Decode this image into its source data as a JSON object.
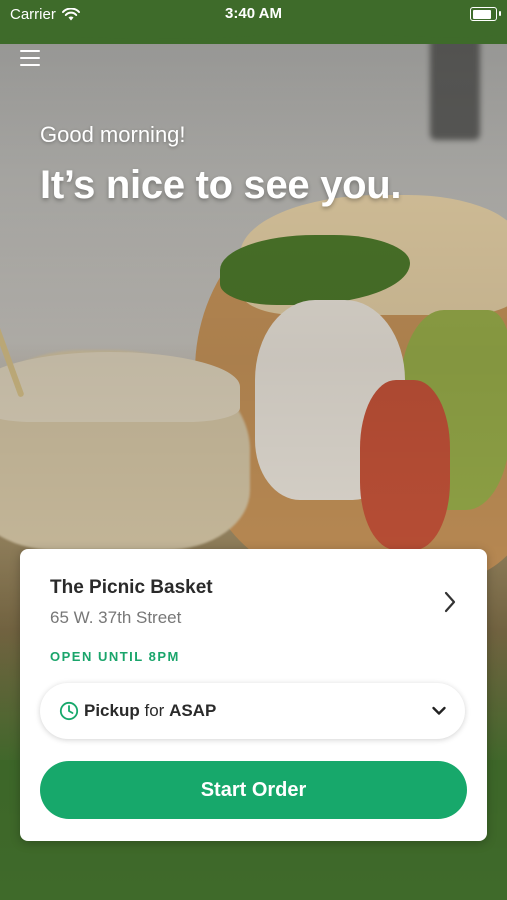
{
  "status_bar": {
    "carrier": "Carrier",
    "time": "3:40 AM",
    "icons": [
      "wifi-icon",
      "battery-icon"
    ]
  },
  "header": {
    "menu_icon": "hamburger-menu-icon",
    "greeting": "Good morning!",
    "headline": "It’s nice to see you."
  },
  "store": {
    "name": "The Picnic Basket",
    "address": "65 W. 37th Street",
    "hours": "OPEN UNTIL 8PM",
    "chevron_icon": "chevron-right-icon"
  },
  "order_mode": {
    "icon": "clock-icon",
    "method": "Pickup",
    "connector": "for",
    "time": "ASAP",
    "dropdown_icon": "chevron-down-icon"
  },
  "start_order": {
    "label": "Start Order"
  },
  "colors": {
    "brand_green": "#3e6b2a",
    "accent_green": "#17a86b",
    "hours_green": "#1aa56b"
  }
}
